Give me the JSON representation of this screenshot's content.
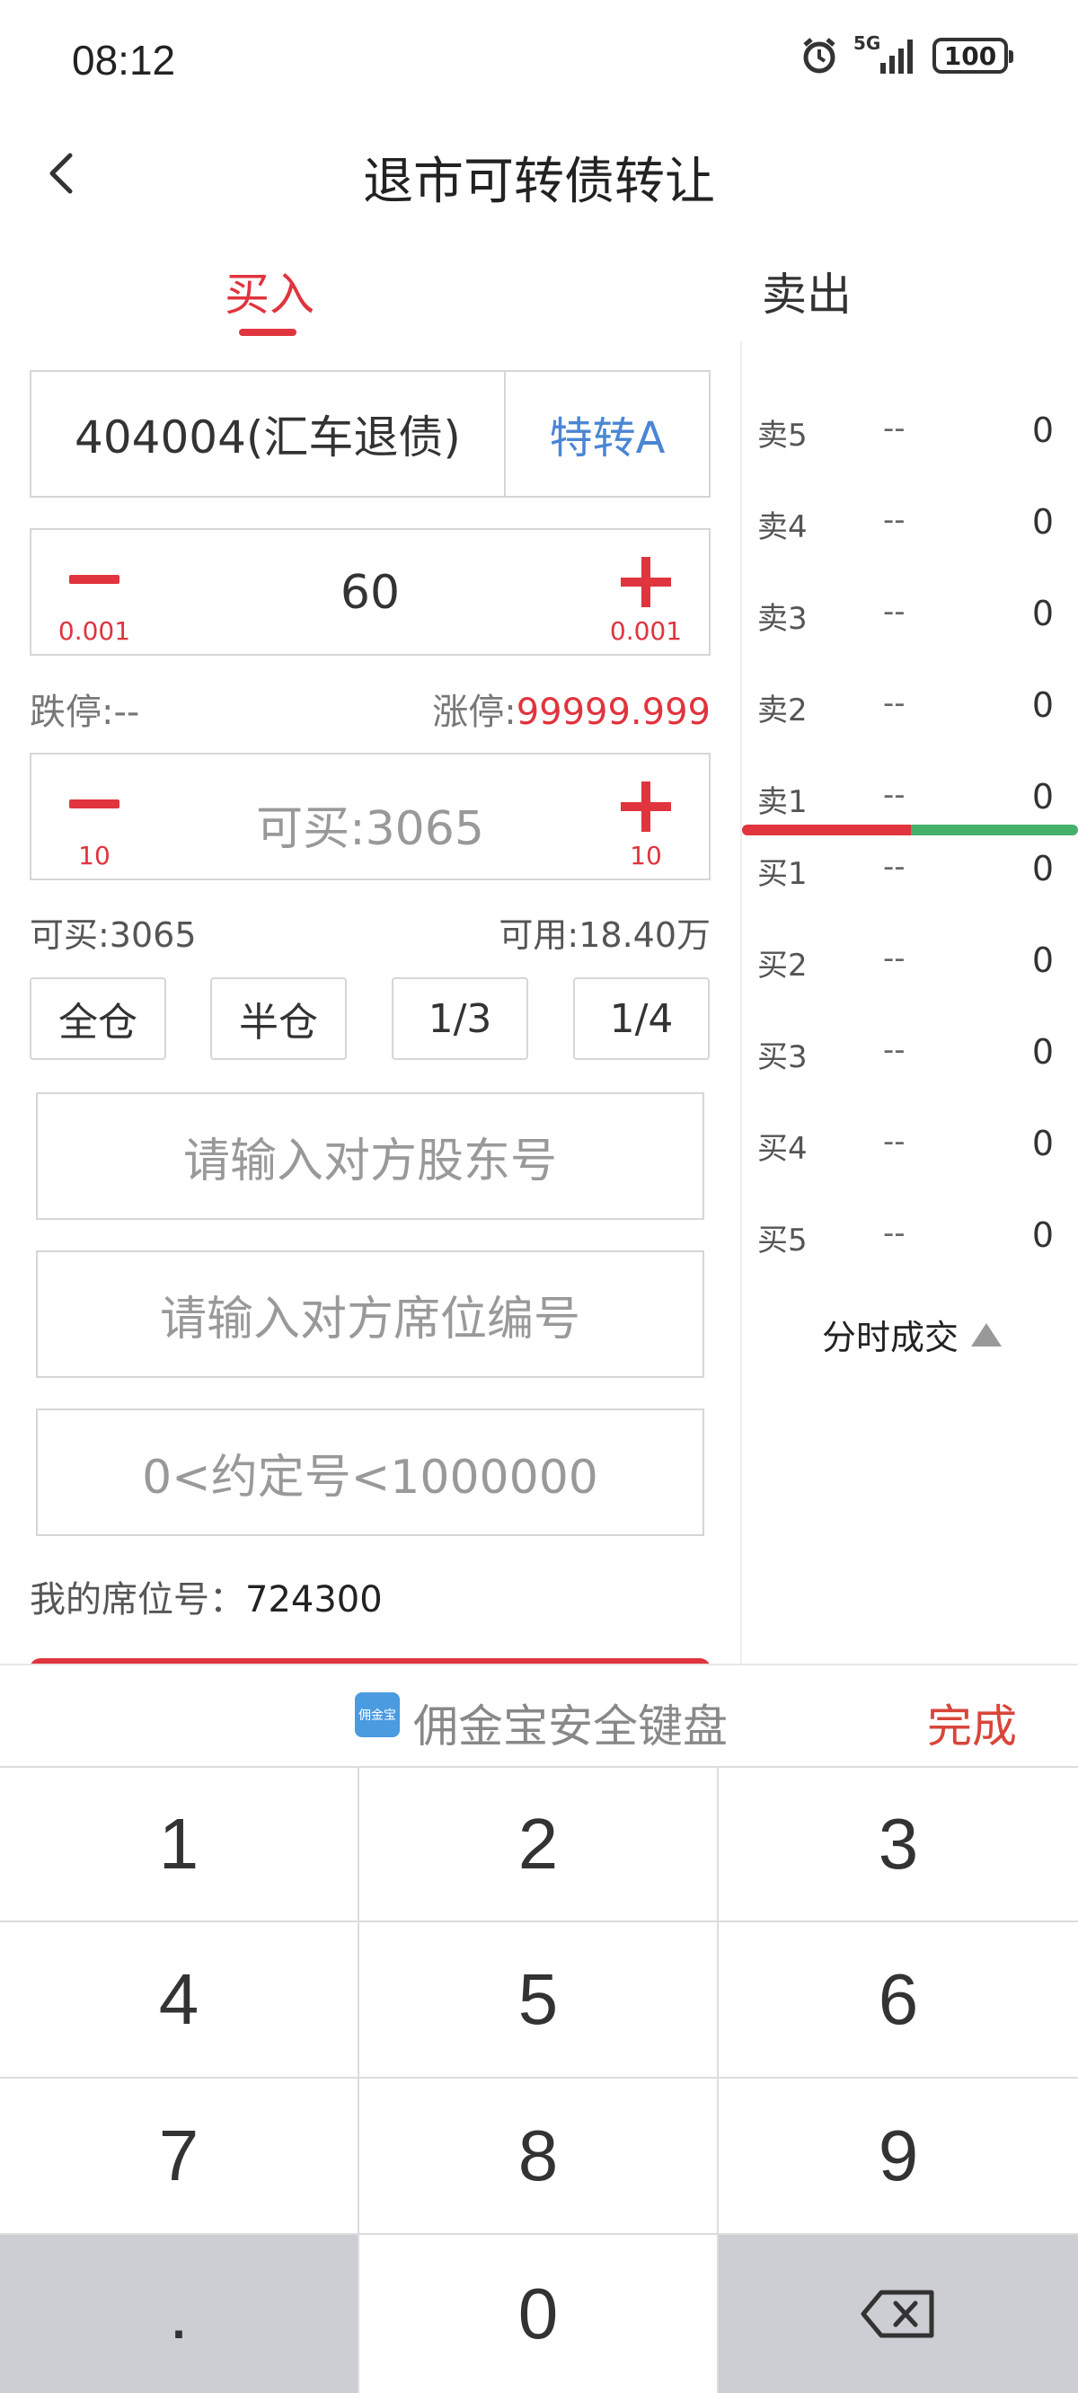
{
  "status_bar": {
    "time": "08:12",
    "network": "5G",
    "battery": "100"
  },
  "header": {
    "title": "退市可转债转让"
  },
  "tabs": {
    "buy": "买入",
    "sell": "卖出"
  },
  "stock": {
    "name": "404004(汇车退债)",
    "type": "特转A"
  },
  "price_stepper": {
    "value": "60",
    "minus_step": "0.001",
    "plus_step": "0.001"
  },
  "limits": {
    "down_label": "跌停:",
    "down_value": "--",
    "up_label": "涨停:",
    "up_value": "99999.999"
  },
  "qty_stepper": {
    "placeholder": "可买:3065",
    "minus_step": "10",
    "plus_step": "10"
  },
  "availability": {
    "can_buy": "可买:3065",
    "available": "可用:18.40万"
  },
  "ratios": [
    "全仓",
    "半仓",
    "1/3",
    "1/4"
  ],
  "fields": {
    "counterparty_holder": "请输入对方股东号",
    "counterparty_seat": "请输入对方席位编号",
    "agreement_no": "0<约定号<1000000"
  },
  "seat": {
    "label": "我的席位号：",
    "value": "724300"
  },
  "order_book": {
    "sell": [
      {
        "label": "卖5",
        "price": "--",
        "volume": "0"
      },
      {
        "label": "卖4",
        "price": "--",
        "volume": "0"
      },
      {
        "label": "卖3",
        "price": "--",
        "volume": "0"
      },
      {
        "label": "卖2",
        "price": "--",
        "volume": "0"
      },
      {
        "label": "卖1",
        "price": "--",
        "volume": "0"
      }
    ],
    "buy": [
      {
        "label": "买1",
        "price": "--",
        "volume": "0"
      },
      {
        "label": "买2",
        "price": "--",
        "volume": "0"
      },
      {
        "label": "买3",
        "price": "--",
        "volume": "0"
      },
      {
        "label": "买4",
        "price": "--",
        "volume": "0"
      },
      {
        "label": "买5",
        "price": "--",
        "volume": "0"
      }
    ],
    "timeshare_label": "分时成交"
  },
  "keyboard": {
    "logo_text": "佣金宝",
    "title": "佣金宝安全键盘",
    "done": "完成",
    "keys": [
      "1",
      "2",
      "3",
      "4",
      "5",
      "6",
      "7",
      "8",
      "9",
      ".",
      "0"
    ]
  },
  "colors": {
    "accent_red": "#e0343e",
    "link_blue": "#4a86d4",
    "green": "#45b06a"
  }
}
